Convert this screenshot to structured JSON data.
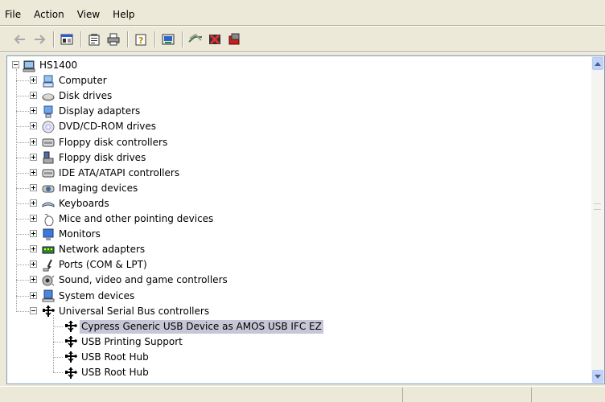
{
  "menu": [
    {
      "label": "File"
    },
    {
      "label": "Action"
    },
    {
      "label": "View"
    },
    {
      "label": "Help"
    }
  ],
  "toolbar": {
    "buttons": [
      {
        "icon": "back-arrow-icon",
        "enabled": false
      },
      {
        "icon": "forward-arrow-icon",
        "enabled": false
      },
      {
        "icon": "show-hide-console-tree-icon",
        "enabled": true
      },
      {
        "icon": "properties-icon",
        "enabled": true
      },
      {
        "icon": "print-icon",
        "enabled": true
      },
      {
        "icon": "help-icon",
        "enabled": true
      },
      {
        "icon": "update-driver-icon",
        "enabled": true
      },
      {
        "icon": "scan-hardware-icon",
        "enabled": true
      },
      {
        "icon": "disable-device-icon",
        "enabled": true
      },
      {
        "icon": "uninstall-icon",
        "enabled": true
      }
    ]
  },
  "tree": {
    "root": {
      "label": "HS1400",
      "icon": "computer-root-icon",
      "expanded": true
    },
    "categories": [
      {
        "label": "Computer",
        "icon": "computer-icon",
        "expanded": false
      },
      {
        "label": "Disk drives",
        "icon": "disk-drive-icon",
        "expanded": false
      },
      {
        "label": "Display adapters",
        "icon": "display-adapter-icon",
        "expanded": false
      },
      {
        "label": "DVD/CD-ROM drives",
        "icon": "cdrom-icon",
        "expanded": false
      },
      {
        "label": "Floppy disk controllers",
        "icon": "controller-icon",
        "expanded": false
      },
      {
        "label": "Floppy disk drives",
        "icon": "floppy-icon",
        "expanded": false
      },
      {
        "label": "IDE ATA/ATAPI controllers",
        "icon": "controller-icon",
        "expanded": false
      },
      {
        "label": "Imaging devices",
        "icon": "camera-icon",
        "expanded": false
      },
      {
        "label": "Keyboards",
        "icon": "keyboard-icon",
        "expanded": false
      },
      {
        "label": "Mice and other pointing devices",
        "icon": "mouse-icon",
        "expanded": false
      },
      {
        "label": "Monitors",
        "icon": "monitor-icon",
        "expanded": false
      },
      {
        "label": "Network adapters",
        "icon": "network-adapter-icon",
        "expanded": false
      },
      {
        "label": "Ports (COM & LPT)",
        "icon": "port-icon",
        "expanded": false
      },
      {
        "label": "Sound, video and game controllers",
        "icon": "sound-icon",
        "expanded": false
      },
      {
        "label": "System devices",
        "icon": "system-device-icon",
        "expanded": false
      },
      {
        "label": "Universal Serial Bus controllers",
        "icon": "usb-icon",
        "expanded": true
      }
    ],
    "usb_children": [
      {
        "label": "Cypress Generic USB Device as AMOS USB IFC EZ",
        "icon": "usb-icon",
        "selected": true
      },
      {
        "label": "USB Printing Support",
        "icon": "usb-icon",
        "selected": false
      },
      {
        "label": "USB Root Hub",
        "icon": "usb-icon",
        "selected": false
      },
      {
        "label": "USB Root Hub",
        "icon": "usb-icon",
        "selected": false
      }
    ]
  },
  "colors": {
    "window_bg": "#ece9d8",
    "selection_bg": "#c6c6d6",
    "tree_border": "#7f9db9"
  }
}
